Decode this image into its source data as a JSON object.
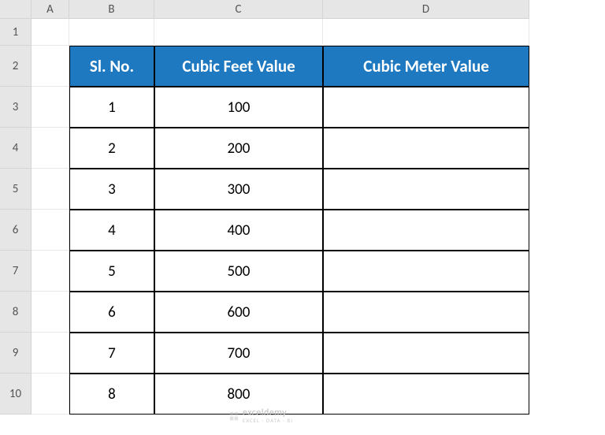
{
  "columns": [
    "",
    "A",
    "B",
    "C",
    "D"
  ],
  "rows": [
    "1",
    "2",
    "3",
    "4",
    "5",
    "6",
    "7",
    "8",
    "9",
    "10"
  ],
  "table": {
    "headers": {
      "sl": "Sl. No.",
      "cf": "Cubic Feet Value",
      "cm": "Cubic Meter Value"
    },
    "data": [
      {
        "sl": "1",
        "cf": "100",
        "cm": ""
      },
      {
        "sl": "2",
        "cf": "200",
        "cm": ""
      },
      {
        "sl": "3",
        "cf": "300",
        "cm": ""
      },
      {
        "sl": "4",
        "cf": "400",
        "cm": ""
      },
      {
        "sl": "5",
        "cf": "500",
        "cm": ""
      },
      {
        "sl": "6",
        "cf": "600",
        "cm": ""
      },
      {
        "sl": "7",
        "cf": "700",
        "cm": ""
      },
      {
        "sl": "8",
        "cf": "800",
        "cm": ""
      }
    ]
  },
  "watermark": {
    "brand": "exceldemy",
    "tagline": "EXCEL · DATA · BI"
  }
}
